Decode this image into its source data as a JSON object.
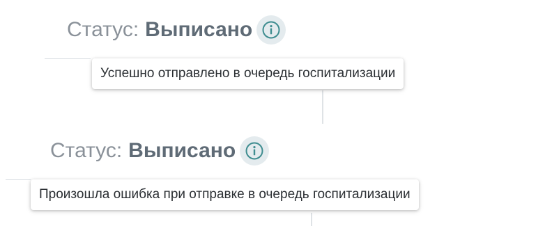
{
  "success_panel": {
    "status_label": "Статус:",
    "status_value": "Выписано",
    "info_icon": "info-circle-icon",
    "tooltip": "Успешно отправлено в очередь госпитализации"
  },
  "error_panel": {
    "status_label": "Статус:",
    "status_value": "Выписано",
    "info_icon": "info-circle-icon",
    "tooltip": "Произошла ошибка при отправке в очередь госпитализации"
  },
  "colors": {
    "label_gray": "#8a9199",
    "value_gray": "#5f6b76",
    "icon_teal": "#3f8d90",
    "icon_bg": "#e4ebee",
    "tooltip_text": "#2b2f33"
  }
}
